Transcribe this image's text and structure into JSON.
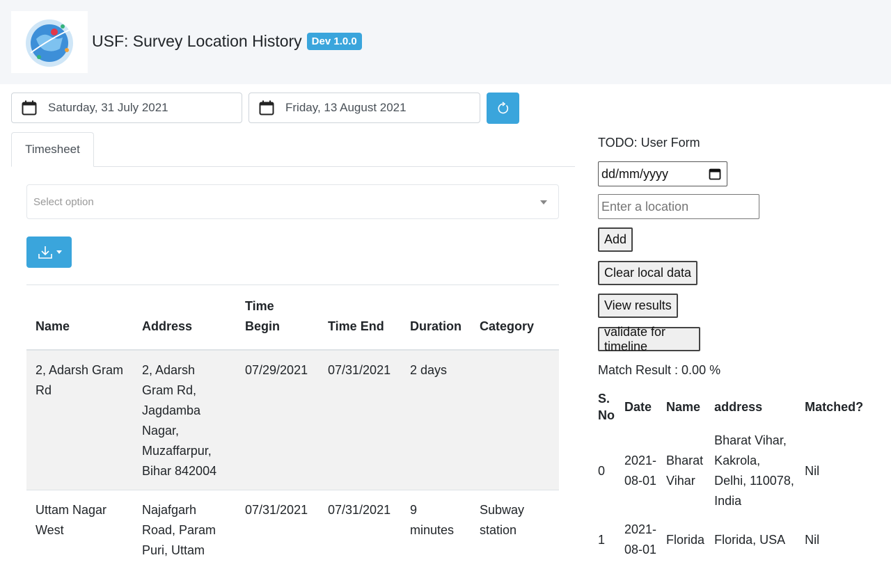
{
  "header": {
    "title": "USF: Survey Location History",
    "version_badge": "Dev 1.0.0",
    "logo_icon": "globe-map-logo-icon"
  },
  "date_range": {
    "start": "Saturday, 31 July 2021",
    "end": "Friday, 13 August 2021"
  },
  "tabs": [
    {
      "label": "Timesheet",
      "active": true
    }
  ],
  "filter": {
    "placeholder": "Select option"
  },
  "timesheet": {
    "columns": [
      "Name",
      "Address",
      "Time Begin",
      "Time End",
      "Duration",
      "Category"
    ],
    "rows": [
      {
        "name": "2, Adarsh Gram Rd",
        "address": "2, Adarsh Gram Rd, Jagdamba Nagar, Muzaffarpur, Bihar 842004",
        "time_begin": "07/29/2021",
        "time_end": "07/31/2021",
        "duration": "2 days",
        "category": ""
      },
      {
        "name": "Uttam Nagar West",
        "address": "Najafgarh Road, Param Puri, Uttam",
        "time_begin": "07/31/2021",
        "time_end": "07/31/2021",
        "duration": "9 minutes",
        "category": "Subway station"
      }
    ]
  },
  "user_form": {
    "title": "TODO: User Form",
    "date_placeholder": "dd/mm/yyyy",
    "location_placeholder": "Enter a location",
    "add_label": "Add",
    "clear_label": "Clear local data",
    "view_label": "View results",
    "validate_label": "validate for timeline",
    "match_result": "Match Result : 0.00 %"
  },
  "results": {
    "columns": [
      "S. No",
      "Date",
      "Name",
      "address",
      "Matched?"
    ],
    "rows": [
      {
        "sno": "0",
        "date": "2021-08-01",
        "name": "Bharat Vihar",
        "address": "Bharat Vihar, Kakrola, Delhi, 110078, India",
        "matched": "Nil"
      },
      {
        "sno": "1",
        "date": "2021-08-01",
        "name": "Florida",
        "address": "Florida, USA",
        "matched": "Nil"
      }
    ]
  },
  "colors": {
    "accent": "#3aa5dc",
    "header_bg": "#f4f6f9"
  }
}
